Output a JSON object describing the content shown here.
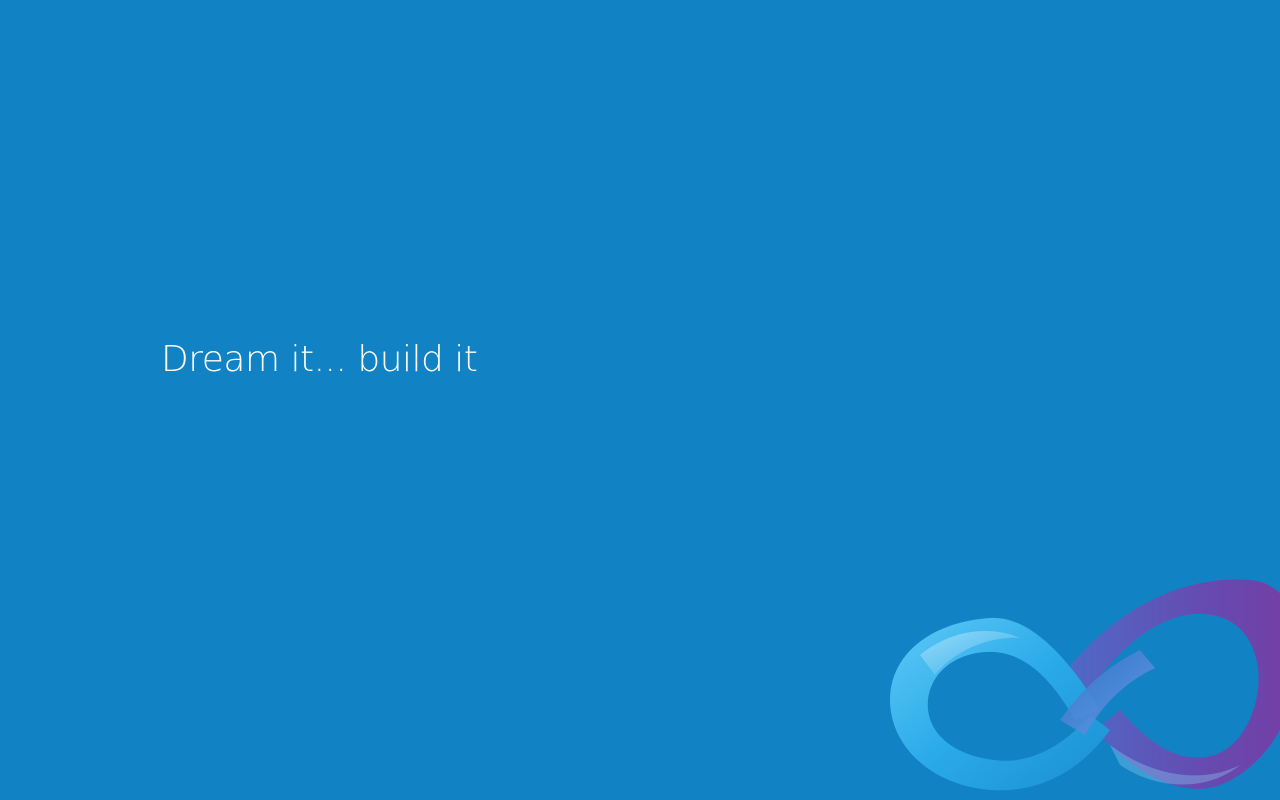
{
  "desktop": {
    "background_color": "#1182c3",
    "tagline": "Dream it... build it",
    "logo": {
      "icon": "infinity-ribbon-icon",
      "colors": [
        "#2bb4ee",
        "#1e9ad8",
        "#5a5fc0",
        "#7b3fa8"
      ]
    }
  }
}
